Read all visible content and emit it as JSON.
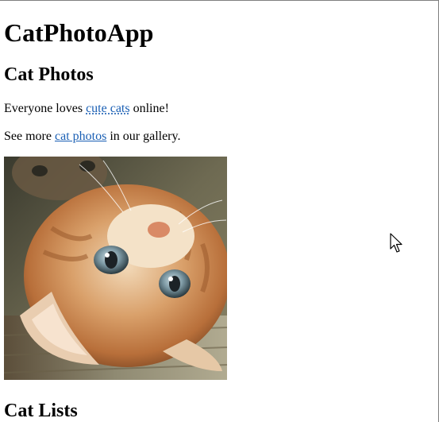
{
  "app": {
    "heading": "CatPhotoApp"
  },
  "photos_section": {
    "heading": "Cat Photos",
    "line1": {
      "before": "Everyone loves ",
      "link": "cute cats",
      "after": " online!"
    },
    "line2": {
      "before": "See more ",
      "link": "cat photos",
      "after": " in our gallery."
    },
    "image": {
      "subject": "orange-tabby-kitten-lying-on-back"
    }
  },
  "lists_section": {
    "heading": "Cat Lists"
  },
  "colors": {
    "link": "#1a5fb4",
    "text": "#000000",
    "background": "#ffffff"
  },
  "icons": {
    "cursor": "mouse-pointer-icon"
  }
}
